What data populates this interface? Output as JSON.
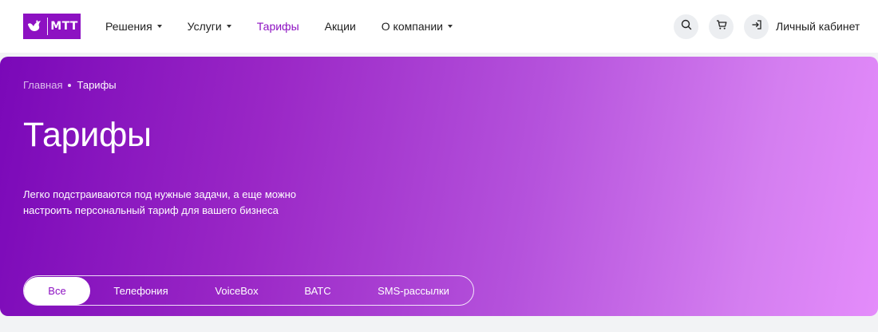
{
  "header": {
    "logo_text": "МТТ",
    "nav": [
      {
        "label": "Решения",
        "dropdown": true,
        "active": false
      },
      {
        "label": "Услуги",
        "dropdown": true,
        "active": false
      },
      {
        "label": "Тарифы",
        "dropdown": false,
        "active": true
      },
      {
        "label": "Акции",
        "dropdown": false,
        "active": false
      },
      {
        "label": "О компании",
        "dropdown": true,
        "active": false
      }
    ],
    "icons": [
      "search-icon",
      "cart-icon",
      "login-icon"
    ],
    "cabinet_label": "Личный кабинет"
  },
  "hero": {
    "breadcrumb": {
      "home": "Главная",
      "current": "Тарифы"
    },
    "title": "Тарифы",
    "description": "Легко подстраиваются под нужные задачи, а еще можно настроить персональный тариф для вашего бизнеса",
    "filter_tabs": [
      {
        "label": "Все",
        "selected": true
      },
      {
        "label": "Телефония",
        "selected": false
      },
      {
        "label": "VoiceBox",
        "selected": false
      },
      {
        "label": "ВАТС",
        "selected": false
      },
      {
        "label": "SMS-рассылки",
        "selected": false
      }
    ]
  },
  "colors": {
    "brand": "#8d11c2",
    "hero_gradient_start": "#7a08b8",
    "hero_gradient_end": "#e48cfb",
    "page_background": "#f2f3f5"
  }
}
